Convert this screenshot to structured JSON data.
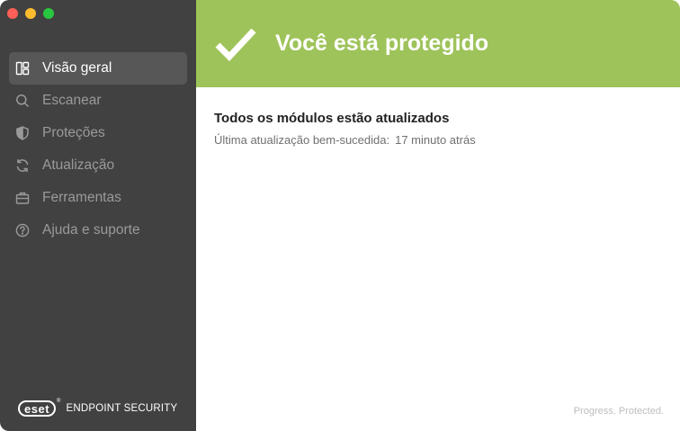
{
  "window": {
    "controls": [
      "close",
      "minimize",
      "maximize"
    ]
  },
  "sidebar": {
    "items": [
      {
        "label": "Visão geral",
        "icon": "dashboard-icon",
        "active": true
      },
      {
        "label": "Escanear",
        "icon": "search-icon",
        "active": false
      },
      {
        "label": "Proteções",
        "icon": "shield-icon",
        "active": false
      },
      {
        "label": "Atualização",
        "icon": "refresh-icon",
        "active": false
      },
      {
        "label": "Ferramentas",
        "icon": "briefcase-icon",
        "active": false
      },
      {
        "label": "Ajuda e suporte",
        "icon": "help-circle-icon",
        "active": false
      }
    ],
    "brand": {
      "logo_text": "eset",
      "registered": "®",
      "product": "ENDPOINT SECURITY"
    }
  },
  "status": {
    "title": "Você está protegido",
    "icon": "checkmark-icon",
    "color": "#9ec35a"
  },
  "content": {
    "modules_title": "Todos os módulos estão atualizados",
    "last_update_label": "Última atualização bem-sucedida:",
    "last_update_value": "17 minuto atrás"
  },
  "footer": {
    "tagline": "Progress. Protected."
  },
  "colors": {
    "sidebar_bg": "#414141",
    "active_item_bg": "#575757",
    "accent_green": "#9ec35a"
  }
}
